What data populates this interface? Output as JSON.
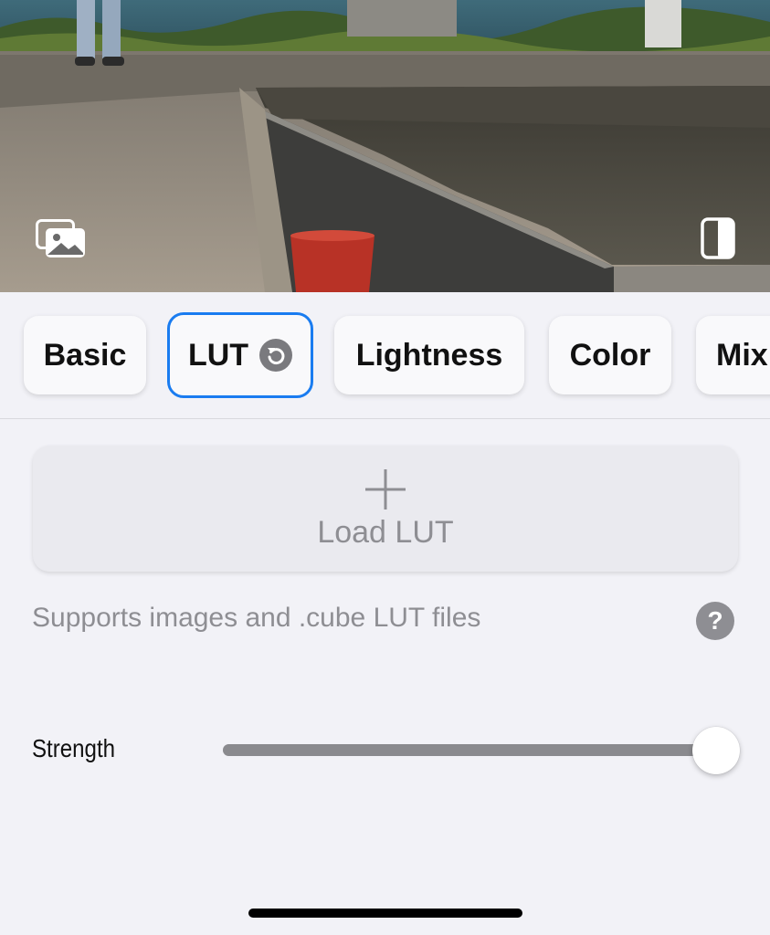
{
  "photo": {
    "gallery_icon": "photo-gallery-icon",
    "compare_icon": "split-compare-icon"
  },
  "tabs": [
    {
      "label": "Basic",
      "selected": false
    },
    {
      "label": "LUT",
      "selected": true,
      "badge_icon": "reset-icon"
    },
    {
      "label": "Lightness",
      "selected": false
    },
    {
      "label": "Color",
      "selected": false
    },
    {
      "label": "Mix",
      "selected": false
    }
  ],
  "lut": {
    "load_label": "Load LUT",
    "load_icon": "plus-icon",
    "hint": "Supports images and .cube LUT files",
    "help_label": "?"
  },
  "strength": {
    "label": "Strength",
    "value": 1.0
  },
  "colors": {
    "accent": "#1a7cf0",
    "background": "#f2f2f7",
    "secondary_text": "#8e8e93",
    "slider_fill": "#8a8a8e"
  }
}
